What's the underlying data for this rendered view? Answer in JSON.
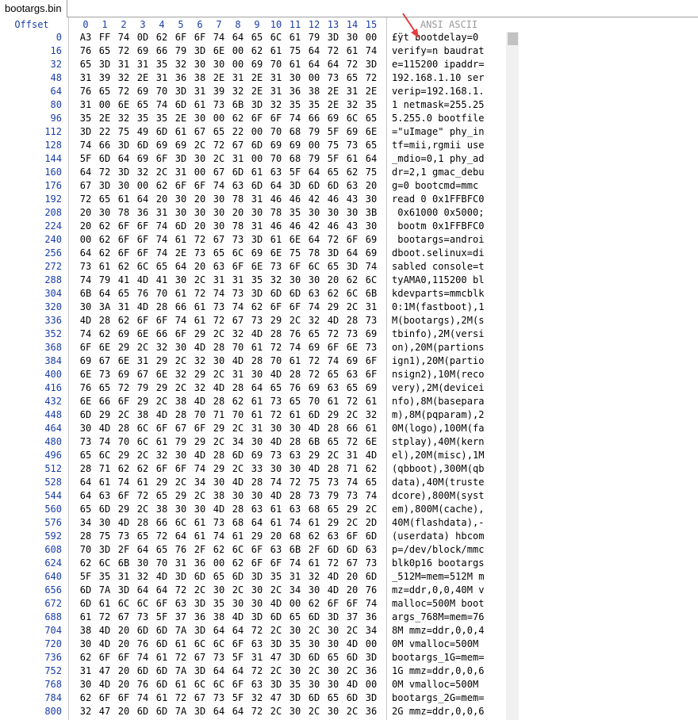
{
  "tab": {
    "title": "bootargs.bin"
  },
  "header": {
    "offset_label": "Offset",
    "columns": [
      "0",
      "1",
      "2",
      "3",
      "4",
      "5",
      "6",
      "7",
      "8",
      "9",
      "10",
      "11",
      "12",
      "13",
      "14",
      "15"
    ],
    "ansi_label": "ANSI ASCII"
  },
  "colors": {
    "header_blue": "#1a3ea8",
    "annotation_red": "#e83b3b"
  },
  "annotation": "red-arrow-icon",
  "rows": [
    {
      "offset": "0",
      "bytes": [
        "A3",
        "FF",
        "74",
        "0D",
        "62",
        "6F",
        "6F",
        "74",
        "64",
        "65",
        "6C",
        "61",
        "79",
        "3D",
        "30",
        "00"
      ],
      "ascii": "£ÿt bootdelay=0"
    },
    {
      "offset": "16",
      "bytes": [
        "76",
        "65",
        "72",
        "69",
        "66",
        "79",
        "3D",
        "6E",
        "00",
        "62",
        "61",
        "75",
        "64",
        "72",
        "61",
        "74"
      ],
      "ascii": "verify=n baudrat"
    },
    {
      "offset": "32",
      "bytes": [
        "65",
        "3D",
        "31",
        "31",
        "35",
        "32",
        "30",
        "30",
        "00",
        "69",
        "70",
        "61",
        "64",
        "64",
        "72",
        "3D"
      ],
      "ascii": "e=115200 ipaddr="
    },
    {
      "offset": "48",
      "bytes": [
        "31",
        "39",
        "32",
        "2E",
        "31",
        "36",
        "38",
        "2E",
        "31",
        "2E",
        "31",
        "30",
        "00",
        "73",
        "65",
        "72"
      ],
      "ascii": "192.168.1.10 ser"
    },
    {
      "offset": "64",
      "bytes": [
        "76",
        "65",
        "72",
        "69",
        "70",
        "3D",
        "31",
        "39",
        "32",
        "2E",
        "31",
        "36",
        "38",
        "2E",
        "31",
        "2E"
      ],
      "ascii": "verip=192.168.1."
    },
    {
      "offset": "80",
      "bytes": [
        "31",
        "00",
        "6E",
        "65",
        "74",
        "6D",
        "61",
        "73",
        "6B",
        "3D",
        "32",
        "35",
        "35",
        "2E",
        "32",
        "35"
      ],
      "ascii": "1 netmask=255.25"
    },
    {
      "offset": "96",
      "bytes": [
        "35",
        "2E",
        "32",
        "35",
        "35",
        "2E",
        "30",
        "00",
        "62",
        "6F",
        "6F",
        "74",
        "66",
        "69",
        "6C",
        "65"
      ],
      "ascii": "5.255.0 bootfile"
    },
    {
      "offset": "112",
      "bytes": [
        "3D",
        "22",
        "75",
        "49",
        "6D",
        "61",
        "67",
        "65",
        "22",
        "00",
        "70",
        "68",
        "79",
        "5F",
        "69",
        "6E"
      ],
      "ascii": "=\"uImage\" phy_in"
    },
    {
      "offset": "128",
      "bytes": [
        "74",
        "66",
        "3D",
        "6D",
        "69",
        "69",
        "2C",
        "72",
        "67",
        "6D",
        "69",
        "69",
        "00",
        "75",
        "73",
        "65"
      ],
      "ascii": "tf=mii,rgmii use"
    },
    {
      "offset": "144",
      "bytes": [
        "5F",
        "6D",
        "64",
        "69",
        "6F",
        "3D",
        "30",
        "2C",
        "31",
        "00",
        "70",
        "68",
        "79",
        "5F",
        "61",
        "64"
      ],
      "ascii": "_mdio=0,1 phy_ad"
    },
    {
      "offset": "160",
      "bytes": [
        "64",
        "72",
        "3D",
        "32",
        "2C",
        "31",
        "00",
        "67",
        "6D",
        "61",
        "63",
        "5F",
        "64",
        "65",
        "62",
        "75"
      ],
      "ascii": "dr=2,1 gmac_debu"
    },
    {
      "offset": "176",
      "bytes": [
        "67",
        "3D",
        "30",
        "00",
        "62",
        "6F",
        "6F",
        "74",
        "63",
        "6D",
        "64",
        "3D",
        "6D",
        "6D",
        "63",
        "20"
      ],
      "ascii": "g=0 bootcmd=mmc "
    },
    {
      "offset": "192",
      "bytes": [
        "72",
        "65",
        "61",
        "64",
        "20",
        "30",
        "20",
        "30",
        "78",
        "31",
        "46",
        "46",
        "42",
        "46",
        "43",
        "30"
      ],
      "ascii": "read 0 0x1FFBFC0"
    },
    {
      "offset": "208",
      "bytes": [
        "20",
        "30",
        "78",
        "36",
        "31",
        "30",
        "30",
        "30",
        "20",
        "30",
        "78",
        "35",
        "30",
        "30",
        "30",
        "3B"
      ],
      "ascii": " 0x61000 0x5000;"
    },
    {
      "offset": "224",
      "bytes": [
        "20",
        "62",
        "6F",
        "6F",
        "74",
        "6D",
        "20",
        "30",
        "78",
        "31",
        "46",
        "46",
        "42",
        "46",
        "43",
        "30"
      ],
      "ascii": " bootm 0x1FFBFC0"
    },
    {
      "offset": "240",
      "bytes": [
        "00",
        "62",
        "6F",
        "6F",
        "74",
        "61",
        "72",
        "67",
        "73",
        "3D",
        "61",
        "6E",
        "64",
        "72",
        "6F",
        "69"
      ],
      "ascii": " bootargs=androi"
    },
    {
      "offset": "256",
      "bytes": [
        "64",
        "62",
        "6F",
        "6F",
        "74",
        "2E",
        "73",
        "65",
        "6C",
        "69",
        "6E",
        "75",
        "78",
        "3D",
        "64",
        "69"
      ],
      "ascii": "dboot.selinux=di"
    },
    {
      "offset": "272",
      "bytes": [
        "73",
        "61",
        "62",
        "6C",
        "65",
        "64",
        "20",
        "63",
        "6F",
        "6E",
        "73",
        "6F",
        "6C",
        "65",
        "3D",
        "74"
      ],
      "ascii": "sabled console=t"
    },
    {
      "offset": "288",
      "bytes": [
        "74",
        "79",
        "41",
        "4D",
        "41",
        "30",
        "2C",
        "31",
        "31",
        "35",
        "32",
        "30",
        "30",
        "20",
        "62",
        "6C"
      ],
      "ascii": "tyAMA0,115200 bl"
    },
    {
      "offset": "304",
      "bytes": [
        "6B",
        "64",
        "65",
        "76",
        "70",
        "61",
        "72",
        "74",
        "73",
        "3D",
        "6D",
        "6D",
        "63",
        "62",
        "6C",
        "6B"
      ],
      "ascii": "kdevparts=mmcblk"
    },
    {
      "offset": "320",
      "bytes": [
        "30",
        "3A",
        "31",
        "4D",
        "28",
        "66",
        "61",
        "73",
        "74",
        "62",
        "6F",
        "6F",
        "74",
        "29",
        "2C",
        "31"
      ],
      "ascii": "0:1M(fastboot),1"
    },
    {
      "offset": "336",
      "bytes": [
        "4D",
        "28",
        "62",
        "6F",
        "6F",
        "74",
        "61",
        "72",
        "67",
        "73",
        "29",
        "2C",
        "32",
        "4D",
        "28",
        "73"
      ],
      "ascii": "M(bootargs),2M(s"
    },
    {
      "offset": "352",
      "bytes": [
        "74",
        "62",
        "69",
        "6E",
        "66",
        "6F",
        "29",
        "2C",
        "32",
        "4D",
        "28",
        "76",
        "65",
        "72",
        "73",
        "69"
      ],
      "ascii": "tbinfo),2M(versi"
    },
    {
      "offset": "368",
      "bytes": [
        "6F",
        "6E",
        "29",
        "2C",
        "32",
        "30",
        "4D",
        "28",
        "70",
        "61",
        "72",
        "74",
        "69",
        "6F",
        "6E",
        "73"
      ],
      "ascii": "on),20M(partions"
    },
    {
      "offset": "384",
      "bytes": [
        "69",
        "67",
        "6E",
        "31",
        "29",
        "2C",
        "32",
        "30",
        "4D",
        "28",
        "70",
        "61",
        "72",
        "74",
        "69",
        "6F"
      ],
      "ascii": "ign1),20M(partio"
    },
    {
      "offset": "400",
      "bytes": [
        "6E",
        "73",
        "69",
        "67",
        "6E",
        "32",
        "29",
        "2C",
        "31",
        "30",
        "4D",
        "28",
        "72",
        "65",
        "63",
        "6F"
      ],
      "ascii": "nsign2),10M(reco"
    },
    {
      "offset": "416",
      "bytes": [
        "76",
        "65",
        "72",
        "79",
        "29",
        "2C",
        "32",
        "4D",
        "28",
        "64",
        "65",
        "76",
        "69",
        "63",
        "65",
        "69"
      ],
      "ascii": "very),2M(devicei"
    },
    {
      "offset": "432",
      "bytes": [
        "6E",
        "66",
        "6F",
        "29",
        "2C",
        "38",
        "4D",
        "28",
        "62",
        "61",
        "73",
        "65",
        "70",
        "61",
        "72",
        "61"
      ],
      "ascii": "nfo),8M(basepara"
    },
    {
      "offset": "448",
      "bytes": [
        "6D",
        "29",
        "2C",
        "38",
        "4D",
        "28",
        "70",
        "71",
        "70",
        "61",
        "72",
        "61",
        "6D",
        "29",
        "2C",
        "32"
      ],
      "ascii": "m),8M(pqparam),2"
    },
    {
      "offset": "464",
      "bytes": [
        "30",
        "4D",
        "28",
        "6C",
        "6F",
        "67",
        "6F",
        "29",
        "2C",
        "31",
        "30",
        "30",
        "4D",
        "28",
        "66",
        "61"
      ],
      "ascii": "0M(logo),100M(fa"
    },
    {
      "offset": "480",
      "bytes": [
        "73",
        "74",
        "70",
        "6C",
        "61",
        "79",
        "29",
        "2C",
        "34",
        "30",
        "4D",
        "28",
        "6B",
        "65",
        "72",
        "6E"
      ],
      "ascii": "stplay),40M(kern"
    },
    {
      "offset": "496",
      "bytes": [
        "65",
        "6C",
        "29",
        "2C",
        "32",
        "30",
        "4D",
        "28",
        "6D",
        "69",
        "73",
        "63",
        "29",
        "2C",
        "31",
        "4D"
      ],
      "ascii": "el),20M(misc),1M"
    },
    {
      "offset": "512",
      "bytes": [
        "28",
        "71",
        "62",
        "62",
        "6F",
        "6F",
        "74",
        "29",
        "2C",
        "33",
        "30",
        "30",
        "4D",
        "28",
        "71",
        "62"
      ],
      "ascii": "(qbboot),300M(qb"
    },
    {
      "offset": "528",
      "bytes": [
        "64",
        "61",
        "74",
        "61",
        "29",
        "2C",
        "34",
        "30",
        "4D",
        "28",
        "74",
        "72",
        "75",
        "73",
        "74",
        "65"
      ],
      "ascii": "data),40M(truste"
    },
    {
      "offset": "544",
      "bytes": [
        "64",
        "63",
        "6F",
        "72",
        "65",
        "29",
        "2C",
        "38",
        "30",
        "30",
        "4D",
        "28",
        "73",
        "79",
        "73",
        "74"
      ],
      "ascii": "dcore),800M(syst"
    },
    {
      "offset": "560",
      "bytes": [
        "65",
        "6D",
        "29",
        "2C",
        "38",
        "30",
        "30",
        "4D",
        "28",
        "63",
        "61",
        "63",
        "68",
        "65",
        "29",
        "2C"
      ],
      "ascii": "em),800M(cache),"
    },
    {
      "offset": "576",
      "bytes": [
        "34",
        "30",
        "4D",
        "28",
        "66",
        "6C",
        "61",
        "73",
        "68",
        "64",
        "61",
        "74",
        "61",
        "29",
        "2C",
        "2D"
      ],
      "ascii": "40M(flashdata),-"
    },
    {
      "offset": "592",
      "bytes": [
        "28",
        "75",
        "73",
        "65",
        "72",
        "64",
        "61",
        "74",
        "61",
        "29",
        "20",
        "68",
        "62",
        "63",
        "6F",
        "6D"
      ],
      "ascii": "(userdata) hbcom"
    },
    {
      "offset": "608",
      "bytes": [
        "70",
        "3D",
        "2F",
        "64",
        "65",
        "76",
        "2F",
        "62",
        "6C",
        "6F",
        "63",
        "6B",
        "2F",
        "6D",
        "6D",
        "63"
      ],
      "ascii": "p=/dev/block/mmc"
    },
    {
      "offset": "624",
      "bytes": [
        "62",
        "6C",
        "6B",
        "30",
        "70",
        "31",
        "36",
        "00",
        "62",
        "6F",
        "6F",
        "74",
        "61",
        "72",
        "67",
        "73"
      ],
      "ascii": "blk0p16 bootargs"
    },
    {
      "offset": "640",
      "bytes": [
        "5F",
        "35",
        "31",
        "32",
        "4D",
        "3D",
        "6D",
        "65",
        "6D",
        "3D",
        "35",
        "31",
        "32",
        "4D",
        "20",
        "6D"
      ],
      "ascii": "_512M=mem=512M m"
    },
    {
      "offset": "656",
      "bytes": [
        "6D",
        "7A",
        "3D",
        "64",
        "64",
        "72",
        "2C",
        "30",
        "2C",
        "30",
        "2C",
        "34",
        "30",
        "4D",
        "20",
        "76"
      ],
      "ascii": "mz=ddr,0,0,40M v"
    },
    {
      "offset": "672",
      "bytes": [
        "6D",
        "61",
        "6C",
        "6C",
        "6F",
        "63",
        "3D",
        "35",
        "30",
        "30",
        "4D",
        "00",
        "62",
        "6F",
        "6F",
        "74"
      ],
      "ascii": "malloc=500M boot"
    },
    {
      "offset": "688",
      "bytes": [
        "61",
        "72",
        "67",
        "73",
        "5F",
        "37",
        "36",
        "38",
        "4D",
        "3D",
        "6D",
        "65",
        "6D",
        "3D",
        "37",
        "36"
      ],
      "ascii": "args_768M=mem=76"
    },
    {
      "offset": "704",
      "bytes": [
        "38",
        "4D",
        "20",
        "6D",
        "6D",
        "7A",
        "3D",
        "64",
        "64",
        "72",
        "2C",
        "30",
        "2C",
        "30",
        "2C",
        "34"
      ],
      "ascii": "8M mmz=ddr,0,0,4"
    },
    {
      "offset": "720",
      "bytes": [
        "30",
        "4D",
        "20",
        "76",
        "6D",
        "61",
        "6C",
        "6C",
        "6F",
        "63",
        "3D",
        "35",
        "30",
        "30",
        "4D",
        "00"
      ],
      "ascii": "0M vmalloc=500M "
    },
    {
      "offset": "736",
      "bytes": [
        "62",
        "6F",
        "6F",
        "74",
        "61",
        "72",
        "67",
        "73",
        "5F",
        "31",
        "47",
        "3D",
        "6D",
        "65",
        "6D",
        "3D"
      ],
      "ascii": "bootargs_1G=mem="
    },
    {
      "offset": "752",
      "bytes": [
        "31",
        "47",
        "20",
        "6D",
        "6D",
        "7A",
        "3D",
        "64",
        "64",
        "72",
        "2C",
        "30",
        "2C",
        "30",
        "2C",
        "36"
      ],
      "ascii": "1G mmz=ddr,0,0,6"
    },
    {
      "offset": "768",
      "bytes": [
        "30",
        "4D",
        "20",
        "76",
        "6D",
        "61",
        "6C",
        "6C",
        "6F",
        "63",
        "3D",
        "35",
        "30",
        "30",
        "4D",
        "00"
      ],
      "ascii": "0M vmalloc=500M "
    },
    {
      "offset": "784",
      "bytes": [
        "62",
        "6F",
        "6F",
        "74",
        "61",
        "72",
        "67",
        "73",
        "5F",
        "32",
        "47",
        "3D",
        "6D",
        "65",
        "6D",
        "3D"
      ],
      "ascii": "bootargs_2G=mem="
    },
    {
      "offset": "800",
      "bytes": [
        "32",
        "47",
        "20",
        "6D",
        "6D",
        "7A",
        "3D",
        "64",
        "64",
        "72",
        "2C",
        "30",
        "2C",
        "30",
        "2C",
        "36"
      ],
      "ascii": "2G mmz=ddr,0,0,6"
    }
  ]
}
